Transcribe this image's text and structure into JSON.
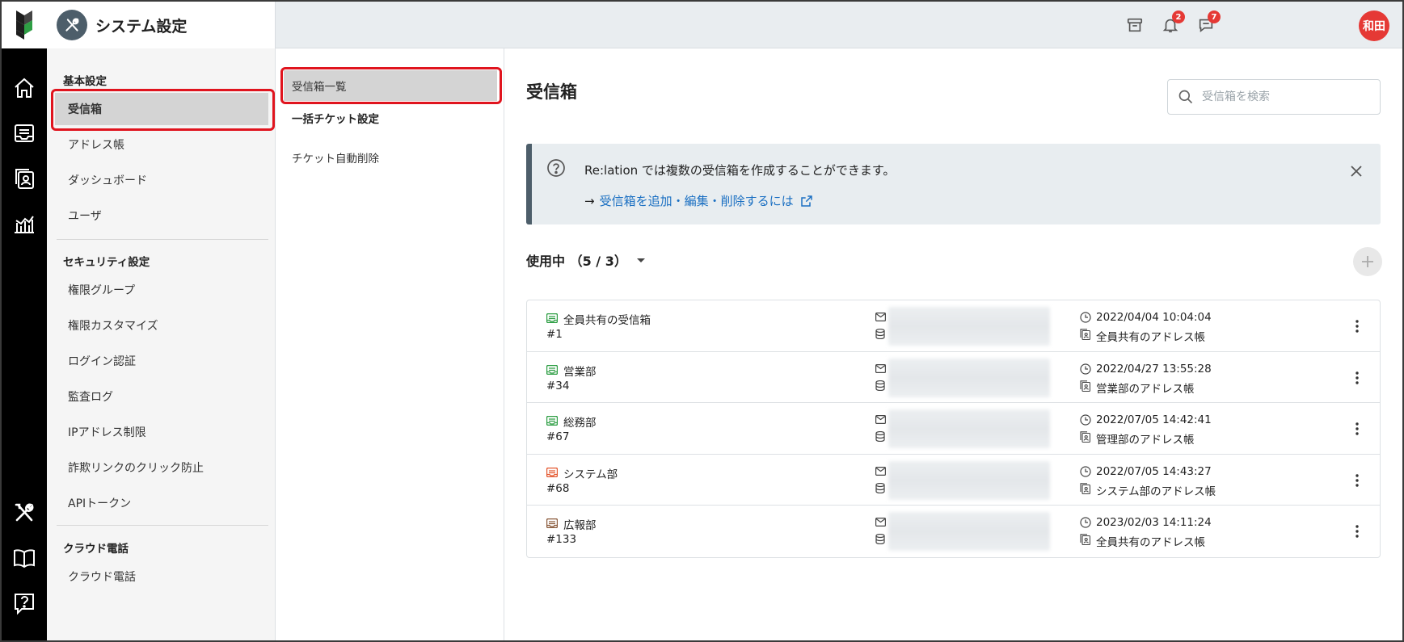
{
  "header": {
    "title": "システム設定",
    "notifications_count": "2",
    "messages_count": "7",
    "avatar": "和田"
  },
  "colors": {
    "accent": "#e0141e",
    "header_bg": "#e9edf0",
    "badge": "#e53935",
    "link": "#1a6fc2",
    "inbox_green": "#2e9e44",
    "inbox_orange": "#e4572e",
    "inbox_brown": "#8a5a3b"
  },
  "sidebar": {
    "groups": [
      {
        "label": "基本設定",
        "items": [
          "受信箱",
          "アドレス帳",
          "ダッシュボード",
          "ユーザ"
        ]
      },
      {
        "label": "セキュリティ設定",
        "items": [
          "権限グループ",
          "権限カスタマイズ",
          "ログイン認証",
          "監査ログ",
          "IPアドレス制限",
          "詐欺リンクのクリック防止",
          "APIトークン"
        ]
      },
      {
        "label": "クラウド電話",
        "items": [
          "クラウド電話"
        ]
      }
    ],
    "active": "受信箱"
  },
  "subpanel": {
    "active_item": "受信箱一覧",
    "group_label": "一括チケット設定",
    "items": [
      "チケット自動削除"
    ]
  },
  "main": {
    "title": "受信箱",
    "search_placeholder": "受信箱を検索",
    "info_text": "Re:lation では複数の受信箱を作成することができます。",
    "info_arrow": "→",
    "info_link": "受信箱を追加・編集・削除するには",
    "section_label": "使用中 （5 / 3）",
    "inboxes": [
      {
        "name": "全員共有の受信箱",
        "id": "#1",
        "date": "2022/04/04 10:04:04",
        "addressbook": "全員共有のアドレス帳",
        "color": "green"
      },
      {
        "name": "営業部",
        "id": "#34",
        "date": "2022/04/27 13:55:28",
        "addressbook": "営業部のアドレス帳",
        "color": "green"
      },
      {
        "name": "総務部",
        "id": "#67",
        "date": "2022/07/05 14:42:41",
        "addressbook": "管理部のアドレス帳",
        "color": "green"
      },
      {
        "name": "システム部",
        "id": "#68",
        "date": "2022/07/05 14:43:27",
        "addressbook": "システム部のアドレス帳",
        "color": "orange"
      },
      {
        "name": "広報部",
        "id": "#133",
        "date": "2023/02/03 14:11:24",
        "addressbook": "全員共有のアドレス帳",
        "color": "brown"
      }
    ]
  },
  "icons": [
    "logo-icon",
    "home-icon",
    "inbox-icon",
    "addressbook-icon",
    "dashboard-icon",
    "settings-tools-icon",
    "manual-book-icon",
    "help-icon",
    "archive-icon",
    "bell-icon",
    "chat-icon",
    "search-icon",
    "question-circle-icon",
    "close-icon",
    "external-link-icon",
    "chevron-down-icon",
    "plus-icon",
    "mail-icon",
    "database-icon",
    "clock-icon",
    "kebab-menu-icon"
  ]
}
